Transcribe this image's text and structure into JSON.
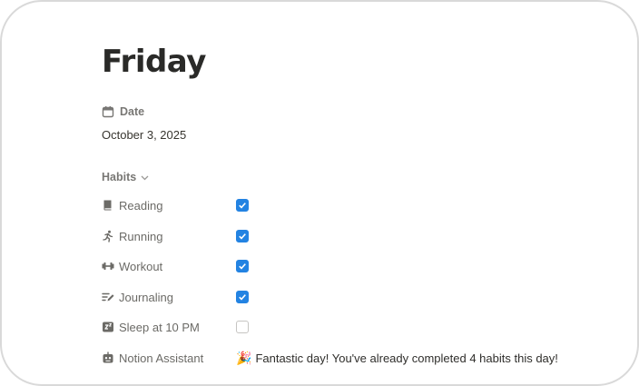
{
  "page": {
    "title": "Friday"
  },
  "date_property": {
    "label": "Date",
    "value": "October 3, 2025",
    "icon": "calendar-icon"
  },
  "habits_group": {
    "label": "Habits",
    "icon": "chevron-down-icon"
  },
  "habits": [
    {
      "label": "Reading",
      "icon": "book-icon",
      "checked": true
    },
    {
      "label": "Running",
      "icon": "runner-icon",
      "checked": true
    },
    {
      "label": "Workout",
      "icon": "dumbbell-icon",
      "checked": true
    },
    {
      "label": "Journaling",
      "icon": "pen-lines-icon",
      "checked": true
    },
    {
      "label": "Sleep at 10 PM",
      "icon": "sleep-icon",
      "checked": false
    }
  ],
  "assistant": {
    "label": "Notion Assistant",
    "icon": "robot-icon",
    "emoji": "🎉",
    "message": "Fantastic day! You've already completed 4 habits this day!"
  },
  "colors": {
    "checkbox_on": "#2383e2",
    "label_gray": "#787774",
    "text": "#37352f"
  }
}
